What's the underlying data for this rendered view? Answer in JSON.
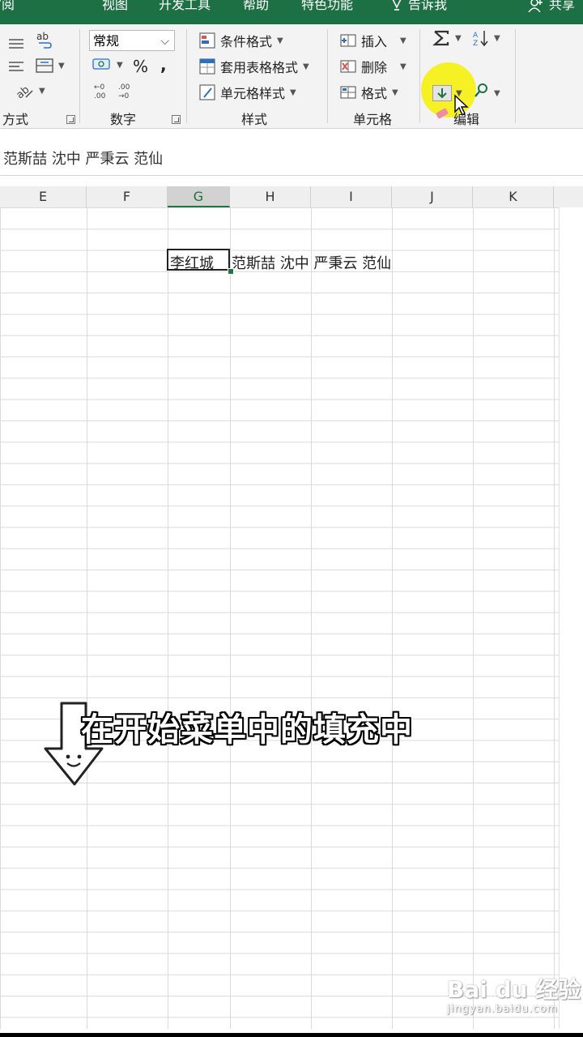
{
  "ribbon_tabs": [
    "审阅",
    "视图",
    "开发工具",
    "帮助",
    "特色功能",
    "告诉我",
    "共享"
  ],
  "groups": {
    "alignment": {
      "label": "方式"
    },
    "number": {
      "label": "数字",
      "format": "常规",
      "percent": "%",
      "comma": ","
    },
    "styles": {
      "label": "样式",
      "conditional": "条件格式",
      "table": "套用表格格式",
      "cell": "单元格样式"
    },
    "cells": {
      "label": "单元格",
      "insert": "插入",
      "delete": "删除",
      "format": "格式"
    },
    "editing": {
      "label": "编辑"
    }
  },
  "formula_bar": {
    "content": "范斯喆 沈中 严秉云 范仙"
  },
  "columns": [
    {
      "letter": "E",
      "selected": false
    },
    {
      "letter": "F",
      "selected": false
    },
    {
      "letter": "G",
      "selected": true
    },
    {
      "letter": "H",
      "selected": false
    },
    {
      "letter": "I",
      "selected": false
    },
    {
      "letter": "J",
      "selected": false
    },
    {
      "letter": "K",
      "selected": false
    }
  ],
  "cells": {
    "active": "李红城",
    "overflow": "范斯喆  沈中  严秉云  范仙"
  },
  "caption": "在开始菜单中的填充中",
  "watermark": {
    "brand": "Bai du 经验",
    "url": "jingyan.baidu.com"
  },
  "colors": {
    "ribbon_green": "#1d7044",
    "accent": "#217346",
    "highlight": "#f6f000"
  }
}
